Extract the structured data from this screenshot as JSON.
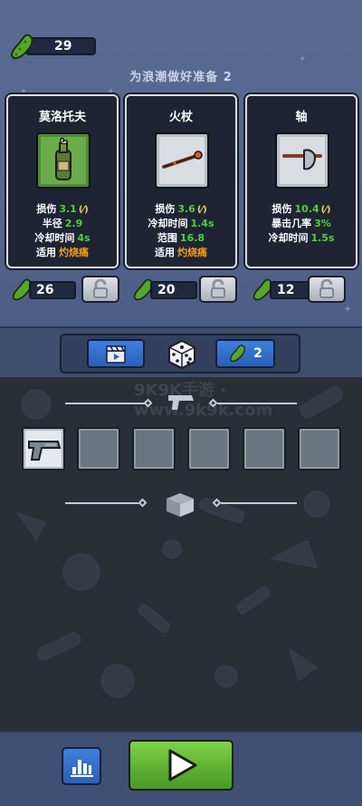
{
  "currency": {
    "amount": "29",
    "icon": "pickle-icon"
  },
  "wave_title": "为浪潮做好准备 2",
  "cards": [
    {
      "name": "莫洛托夫",
      "icon": "molotov-icon",
      "stats": [
        {
          "label": "损伤",
          "value": "3.1",
          "extra": "(⁄)"
        },
        {
          "label": "半径",
          "value": "2.9"
        },
        {
          "label": "冷却时间",
          "value": "4s"
        },
        {
          "label": "适用",
          "value": "灼烧痛",
          "orange": true
        }
      ],
      "price": "26"
    },
    {
      "name": "火杖",
      "icon": "fire-staff-icon",
      "stats": [
        {
          "label": "损伤",
          "value": "3.6",
          "extra": "(⁄)"
        },
        {
          "label": "冷却时间",
          "value": "1.4s"
        },
        {
          "label": "范围",
          "value": "16.8"
        },
        {
          "label": "适用",
          "value": "灼烧痛",
          "orange": true
        }
      ],
      "price": "20"
    },
    {
      "name": "轴",
      "icon": "axe-icon",
      "stats": [
        {
          "label": "损伤",
          "value": "10.4",
          "extra": "(⁄)"
        },
        {
          "label": "暴击几率",
          "value": "3%"
        },
        {
          "label": "冷却时间",
          "value": "1.5s"
        }
      ],
      "price": "12"
    }
  ],
  "reroll": {
    "count": "2",
    "icon": "pickle-icon"
  },
  "watermark": "9K9K手游 · www.9k9k.com",
  "colors": {
    "stat_green": "#4fd13a",
    "stat_orange": "#f29b1e",
    "play_green": "#5fb133",
    "button_blue": "#2f6ccc"
  }
}
